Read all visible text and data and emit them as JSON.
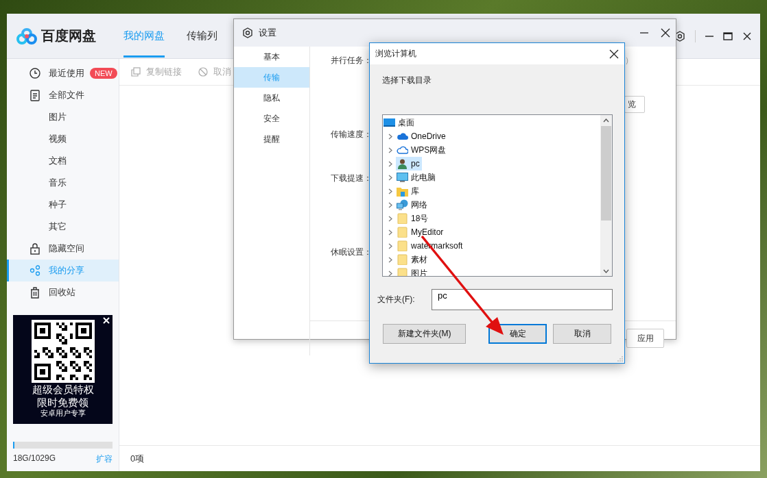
{
  "app": {
    "logo": "百度网盘",
    "tabs": [
      {
        "label": "我的网盘",
        "selected": true
      },
      {
        "label": "传输列",
        "selected": false
      }
    ],
    "sidebar": {
      "items": [
        {
          "label": "最近使用",
          "kind": "clock",
          "badge": "NEW",
          "selected": false
        },
        {
          "label": "全部文件",
          "kind": "document",
          "selected": false,
          "children": [
            {
              "label": "图片",
              "selected": false
            },
            {
              "label": "视频",
              "selected": false
            },
            {
              "label": "文档",
              "selected": false
            },
            {
              "label": "音乐",
              "selected": false
            },
            {
              "label": "种子",
              "selected": false
            },
            {
              "label": "其它",
              "selected": false
            }
          ]
        },
        {
          "label": "隐藏空间",
          "kind": "lock",
          "selected": false
        },
        {
          "label": "我的分享",
          "kind": "share",
          "selected": true
        },
        {
          "label": "回收站",
          "kind": "trash",
          "selected": false
        }
      ]
    },
    "ad": {
      "lines": [
        "超级会员特权",
        "限时免费领",
        "安卓用户专享"
      ]
    },
    "storage": {
      "usage": "18G/1029G",
      "level": 0.017,
      "action": "扩容"
    },
    "toolbar": [
      {
        "label": "复制链接",
        "kind": "copy"
      },
      {
        "label": "取消",
        "kind": "cancel"
      }
    ],
    "status_bar": "0项"
  },
  "settings_dialog": {
    "title": "设置",
    "nav": [
      {
        "label": "基本",
        "selected": false
      },
      {
        "label": "传输",
        "selected": true
      },
      {
        "label": "隐私",
        "selected": false
      },
      {
        "label": "安全",
        "selected": false
      },
      {
        "label": "提醒",
        "selected": false
      }
    ],
    "rows": [
      {
        "label": "并行任务：",
        "hint": "）",
        "button": "览"
      },
      {
        "label": "传输速度："
      },
      {
        "label": "下载提速："
      },
      {
        "label": "休眠设置："
      }
    ],
    "apply_button": "应用"
  },
  "browse_dialog": {
    "title": "浏览计算机",
    "prompt": "选择下载目录",
    "tree": [
      {
        "label": "桌面",
        "kind": "desktop",
        "selected": false,
        "children": [
          {
            "label": "OneDrive",
            "kind": "cloud",
            "selected": false
          },
          {
            "label": "WPS网盘",
            "kind": "cloud-outline",
            "selected": false
          },
          {
            "label": "pc",
            "kind": "user",
            "selected": true
          },
          {
            "label": "此电脑",
            "kind": "computer",
            "selected": false
          },
          {
            "label": "库",
            "kind": "library",
            "selected": false
          },
          {
            "label": "网络",
            "kind": "network",
            "selected": false
          },
          {
            "label": "18号",
            "kind": "folder",
            "selected": false
          },
          {
            "label": "MyEditor",
            "kind": "folder",
            "selected": false
          },
          {
            "label": "watermarksoft",
            "kind": "folder",
            "selected": false
          },
          {
            "label": "素材",
            "kind": "folder",
            "selected": false
          },
          {
            "label": "图片",
            "kind": "folder",
            "selected": false
          }
        ]
      }
    ],
    "folder_label": "文件夹(F):",
    "folder_value": "pc",
    "buttons": [
      {
        "label": "新建文件夹(M)",
        "default": false
      },
      {
        "label": "确定",
        "default": true
      },
      {
        "label": "取消",
        "default": false
      }
    ]
  }
}
